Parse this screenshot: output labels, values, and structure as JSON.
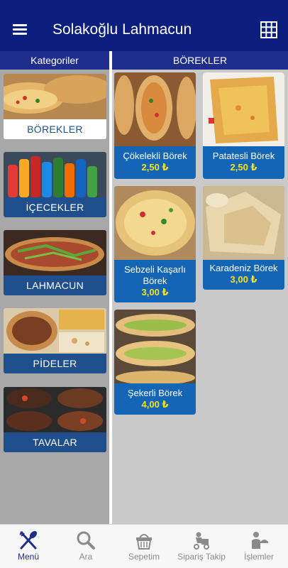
{
  "appbar": {
    "title": "Solakoğlu Lahmacun"
  },
  "categories": {
    "header": "Kategoriler",
    "items": [
      {
        "label": "BÖREKLER"
      },
      {
        "label": "İÇECEKLER"
      },
      {
        "label": "LAHMACUN"
      },
      {
        "label": "PİDELER"
      },
      {
        "label": "TAVALAR"
      }
    ]
  },
  "products": {
    "header": "BÖREKLER",
    "items": [
      {
        "name": "Çökelekli Börek",
        "price": "2,50 ₺"
      },
      {
        "name": "Patatesli Börek",
        "price": "2,50 ₺"
      },
      {
        "name": "Sebzeli Kaşarlı Börek",
        "price": "3,00 ₺"
      },
      {
        "name": "Karadeniz Börek",
        "price": "3,00 ₺"
      },
      {
        "name": "Şekerli Börek",
        "price": "4,00 ₺"
      }
    ]
  },
  "tabbar": {
    "items": [
      {
        "label": "Menü",
        "icon": "fork-knife-icon"
      },
      {
        "label": "Ara",
        "icon": "search-icon"
      },
      {
        "label": "Sepetim",
        "icon": "basket-icon"
      },
      {
        "label": "Sipariş Takip",
        "icon": "delivery-icon"
      },
      {
        "label": "İşlemler",
        "icon": "waiter-icon"
      }
    ]
  },
  "colors": {
    "brand": "#0d1f7e",
    "card": "#1565b6",
    "price": "#f5e21f",
    "active_tab": "#1f2e8c"
  }
}
